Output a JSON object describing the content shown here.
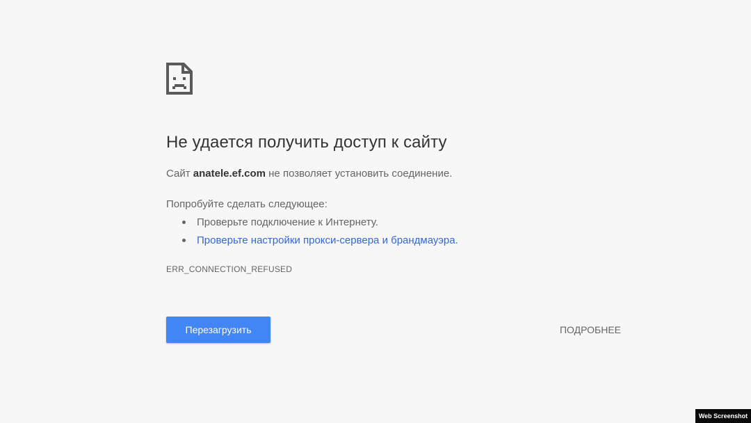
{
  "icon": {
    "name": "sad-page-icon"
  },
  "main": {
    "title": "Не удается получить доступ к сайту",
    "summary_prefix": "Сайт ",
    "summary_host": "anatele.ef.com",
    "summary_suffix": " не позволяет установить соединение.",
    "suggestions_heading": "Попробуйте сделать следующее:",
    "suggestions": [
      {
        "text": "Проверьте подключение к Интернету.",
        "is_link": false
      },
      {
        "text": "Проверьте настройки прокси-сервера и брандмауэра.",
        "is_link": true
      }
    ],
    "error_code": "ERR_CONNECTION_REFUSED"
  },
  "buttons": {
    "reload_label": "Перезагрузить",
    "details_label": "ПОДРОБНЕЕ"
  },
  "watermark": {
    "text": "Web Screenshot"
  },
  "colors": {
    "background": "#f7f7f7",
    "primary_button": "#4285f4",
    "link": "#3367d6",
    "title_text": "#333333",
    "body_text": "#646464"
  }
}
